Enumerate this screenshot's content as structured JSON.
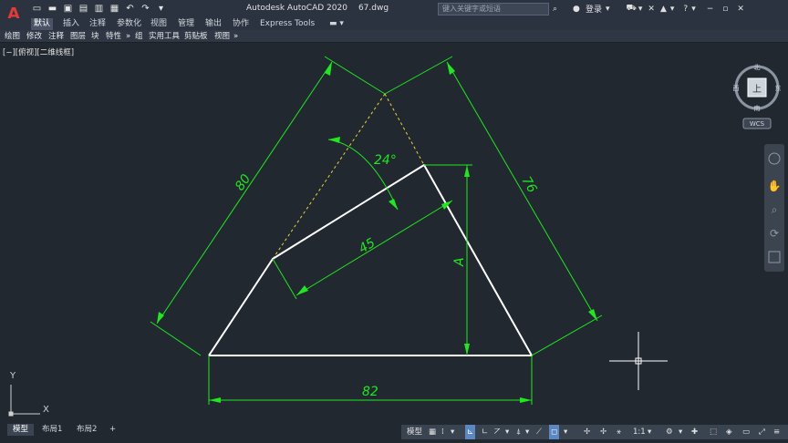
{
  "app": {
    "title": "Autodesk AutoCAD 2020",
    "file": "67.dwg",
    "logo_letter": "A"
  },
  "search": {
    "placeholder": "键入关键字或短语"
  },
  "account": {
    "login_label": "登录"
  },
  "ribbon": {
    "tabs": [
      "默认",
      "插入",
      "注释",
      "参数化",
      "视图",
      "管理",
      "输出",
      "协作",
      "Express Tools"
    ],
    "active_tab": "默认",
    "panels": [
      "绘图",
      "修改",
      "注释",
      "图层",
      "块",
      "特性",
      "组",
      "实用工具",
      "剪贴板",
      "视图"
    ]
  },
  "viewport": {
    "label": "[−][俯视][二维线框]"
  },
  "viewcube": {
    "north": "北",
    "south": "南",
    "east": "东",
    "west": "西",
    "face": "上",
    "wcs": "WCS"
  },
  "drawing": {
    "dim_80": "80",
    "dim_76": "76",
    "dim_24": "24°",
    "dim_45": "45",
    "dim_A": "A",
    "dim_82": "82",
    "line_color": "#ffffff",
    "dim_color": "#1ee81e",
    "hidden_color": "#e8d23a"
  },
  "ucs": {
    "x": "X",
    "y": "Y"
  },
  "layouts": [
    "模型",
    "布局1",
    "布局2"
  ],
  "layouts_add": "+",
  "status": {
    "model": "模型",
    "scale": "1:1"
  }
}
